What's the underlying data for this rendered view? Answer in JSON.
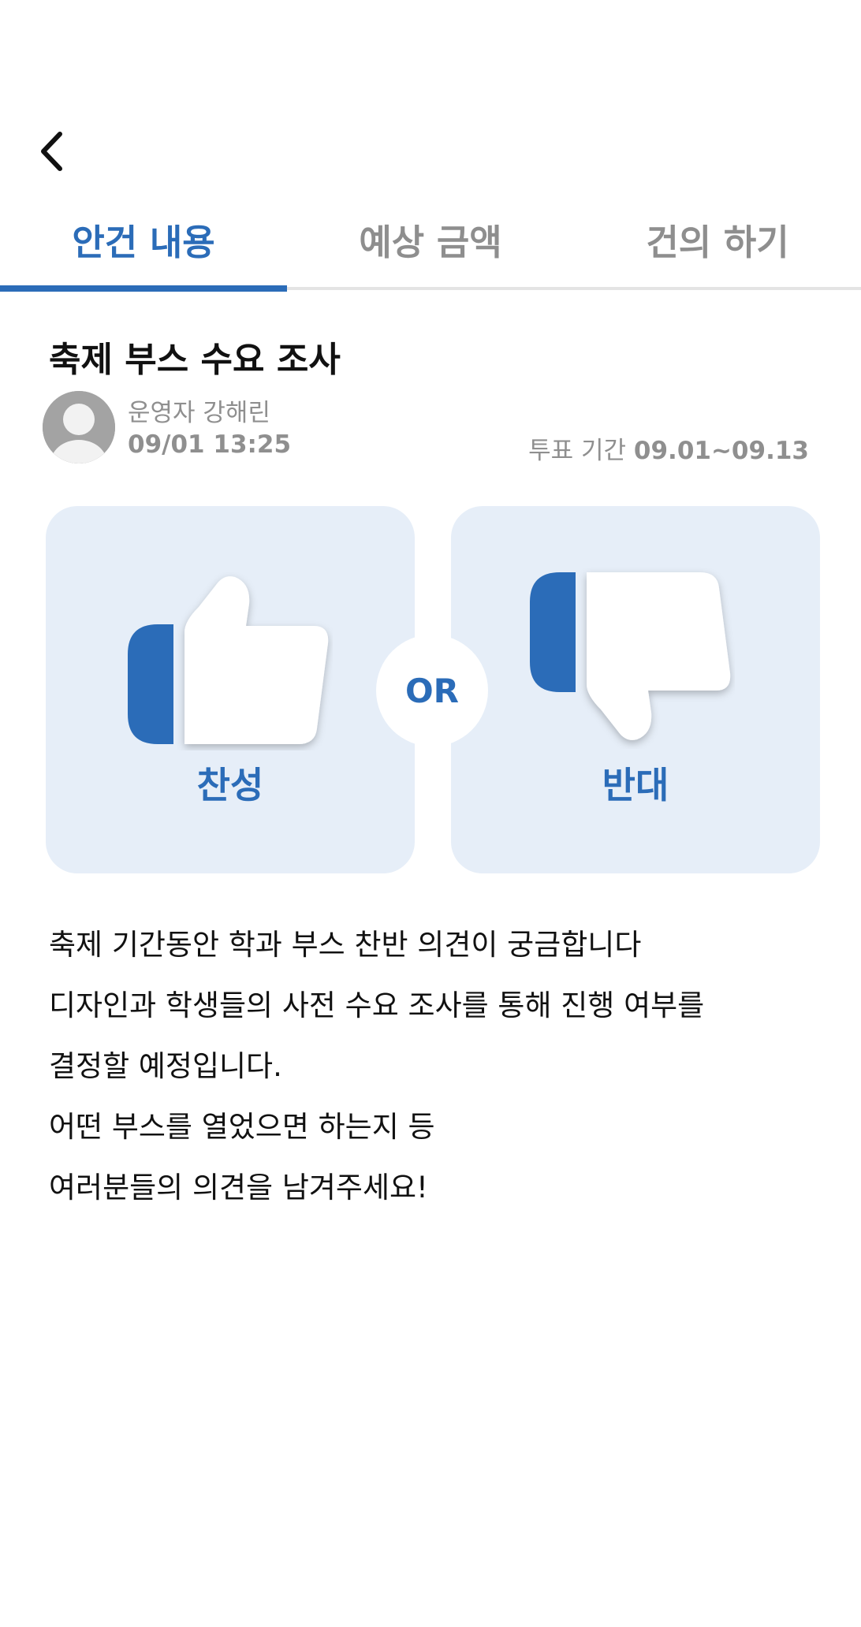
{
  "header": {
    "back_icon": "chevron-left-icon"
  },
  "tabs": [
    {
      "label": "안건 내용",
      "active": true
    },
    {
      "label": "예상 금액",
      "active": false
    },
    {
      "label": "건의 하기",
      "active": false
    }
  ],
  "post": {
    "title": "축제 부스 수요 조사",
    "author": "운영자 강해린",
    "posted_at": "09/01 13:25",
    "vote_period_label": "투표 기간",
    "vote_period_value": "09.01~09.13",
    "avatar_icon": "user-avatar-icon"
  },
  "vote": {
    "agree_label": "찬성",
    "disagree_label": "반대",
    "or_label": "OR",
    "agree_icon": "thumbs-up-icon",
    "disagree_icon": "thumbs-down-icon"
  },
  "body": {
    "lines": [
      "축제 기간동안 학과 부스 찬반 의견이 궁금합니다",
      "디자인과 학생들의 사전 수요 조사를 통해 진행 여부를",
      "결정할 예정입니다.",
      "어떤 부스를 열었으면 하는지 등",
      "여러분들의 의견을 남겨주세요!"
    ]
  },
  "colors": {
    "accent": "#2b6cb8",
    "card_bg": "#e6eef8",
    "muted_text": "#8f8f8f",
    "primary_text": "#111111"
  }
}
